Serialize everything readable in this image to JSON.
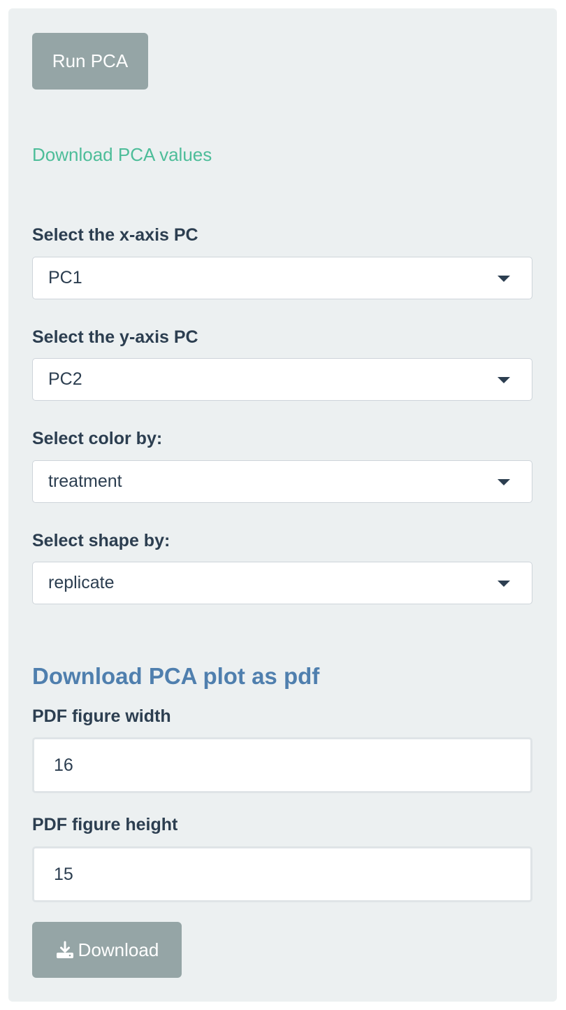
{
  "run_button": {
    "label": "Run PCA"
  },
  "download_values_link": {
    "label": "Download PCA values"
  },
  "selects": [
    {
      "label": "Select the x-axis PC",
      "value": "PC1"
    },
    {
      "label": "Select the y-axis PC",
      "value": "PC2"
    },
    {
      "label": "Select color by:",
      "value": "treatment"
    },
    {
      "label": "Select shape by:",
      "value": "replicate"
    }
  ],
  "pdf_section": {
    "title": "Download PCA plot as pdf",
    "width": {
      "label": "PDF figure width",
      "value": "16"
    },
    "height": {
      "label": "PDF figure height",
      "value": "15"
    },
    "download_button": {
      "label": "Download",
      "icon": "download-icon"
    }
  },
  "colors": {
    "panel_bg": "#ecf0f1",
    "button_bg": "#95a5a6",
    "link": "#4dbd99",
    "section_title": "#4f7fae",
    "text": "#2c3e50"
  }
}
